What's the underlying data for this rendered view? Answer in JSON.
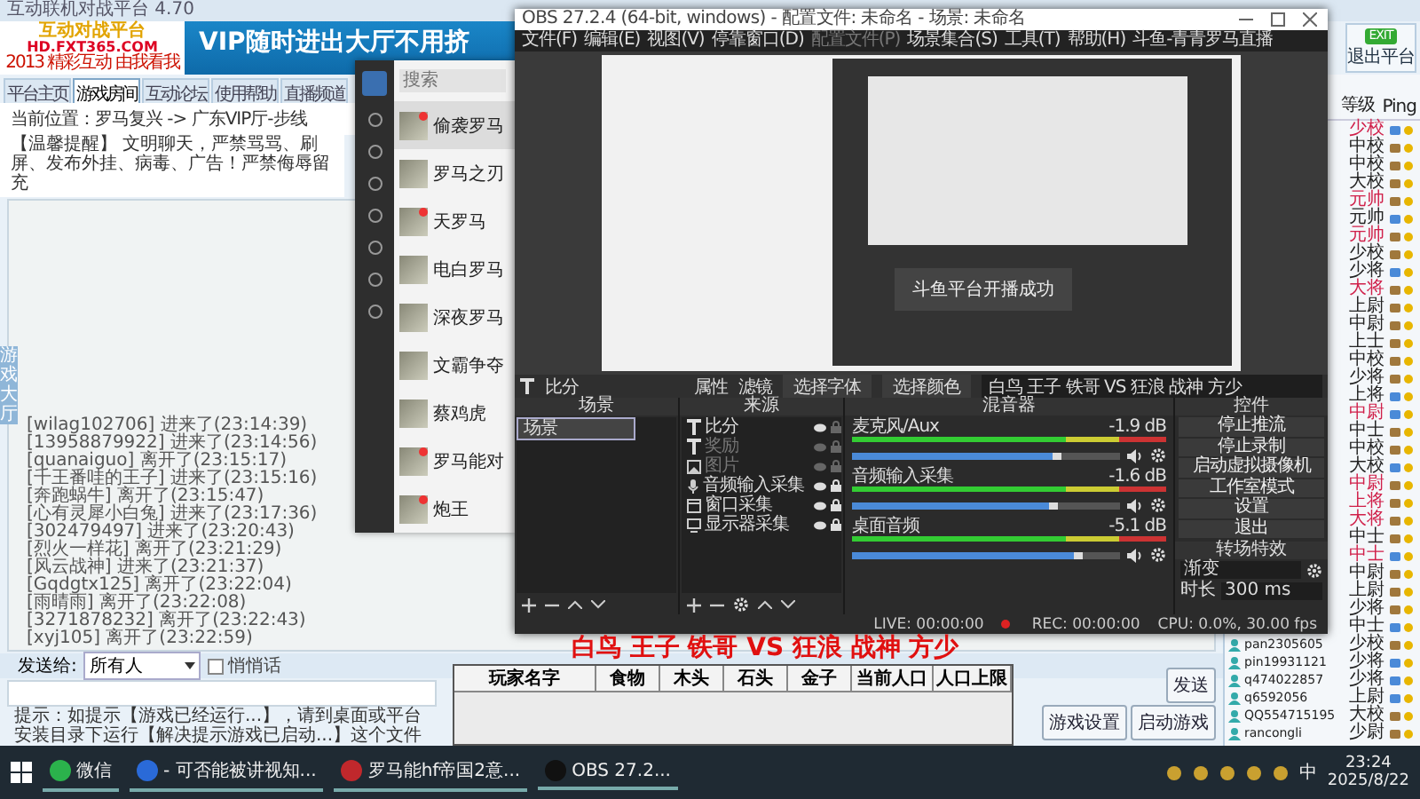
{
  "platform": {
    "title": "互动联机对战平台 4.70",
    "logo": {
      "name": "互动对战平台",
      "site": "HD.FXT365.COM",
      "slogan": "2013 精彩互动 由我看我"
    },
    "banner": "VIP随时进出大厅不用挤",
    "tabs": [
      {
        "label": "平台主页",
        "selected": false
      },
      {
        "label": "游戏房间",
        "selected": true
      },
      {
        "label": "互动论坛",
        "selected": false
      },
      {
        "label": "使用帮助",
        "selected": false
      },
      {
        "label": "直播频道",
        "selected": false
      }
    ],
    "breadcrumb": "当前位置：罗马复兴 -> 广东VIP厅-步线",
    "notice": "【温馨提醒】 文明聊天，严禁骂骂、刷屏、发布外挂、病毒、广告！严禁侮辱留充",
    "side_tab": "游戏大厅",
    "log": [
      "[wilag102706] 进来了(23:14:39)",
      "[13958879922] 进来了(23:14:56)",
      "[quanaiguo] 离开了(23:15:17)",
      "[千王番哇的王子] 进来了(23:15:16)",
      "[奔跑蜗牛] 离开了(23:15:47)",
      "[心有灵犀小白兔] 进来了(23:17:36)",
      "[302479497] 进来了(23:20:43)",
      "[烈火一样花] 离开了(23:21:29)",
      "[风云战神] 进来了(23:21:37)",
      "[Gqdgtx125] 离开了(23:22:04)",
      "[雨晴雨] 离开了(23:22:08)",
      "[3271878232] 离开了(23:22:43)",
      "[xyj105] 离开了(23:22:59)"
    ],
    "send_to": {
      "label": "发送给:",
      "value": "所有人"
    },
    "whisper": {
      "label": "悄悄话",
      "checked": false
    },
    "hint": "提示：如提示【游戏已经运行...】，请到桌面或平台安装目录下运行【解决提示游戏已启动...】这个文件",
    "send_button": "发送",
    "buttons": [
      "游戏设置",
      "启动游戏"
    ],
    "exit_icon": "EXIT",
    "exit_button": "退出平台",
    "user_columns": [
      "等级",
      "Ping"
    ],
    "users": [
      {
        "rank": "少校",
        "vip": true,
        "pc": false
      },
      {
        "rank": "中校",
        "vip": false,
        "pc": true
      },
      {
        "rank": "中校",
        "vip": false,
        "pc": true
      },
      {
        "rank": "大校",
        "vip": false,
        "pc": true
      },
      {
        "rank": "元帅",
        "vip": true,
        "pc": true
      },
      {
        "rank": "元帅",
        "vip": false,
        "pc": false
      },
      {
        "rank": "元帅",
        "vip": true,
        "pc": true
      },
      {
        "rank": "少校",
        "vip": false,
        "pc": true
      },
      {
        "rank": "少将",
        "vip": false,
        "pc": false
      },
      {
        "rank": "大将",
        "vip": true,
        "pc": true
      },
      {
        "rank": "上尉",
        "vip": false,
        "pc": true
      },
      {
        "rank": "中尉",
        "vip": false,
        "pc": true
      },
      {
        "rank": "上士",
        "vip": false,
        "pc": true
      },
      {
        "rank": "中校",
        "vip": false,
        "pc": true
      },
      {
        "rank": "少将",
        "vip": false,
        "pc": true
      },
      {
        "rank": "上将",
        "vip": false,
        "pc": false
      },
      {
        "rank": "中尉",
        "vip": true,
        "pc": false
      },
      {
        "rank": "中士",
        "vip": false,
        "pc": true
      },
      {
        "rank": "中校",
        "vip": false,
        "pc": true
      },
      {
        "rank": "大校",
        "vip": false,
        "pc": false
      },
      {
        "rank": "中尉",
        "vip": true,
        "pc": true
      },
      {
        "rank": "上将",
        "vip": true,
        "pc": true
      },
      {
        "rank": "大将",
        "vip": true,
        "pc": true
      },
      {
        "rank": "中士",
        "vip": false,
        "pc": true
      },
      {
        "rank": "中士",
        "vip": true,
        "pc": false
      },
      {
        "rank": "中尉",
        "vip": false,
        "pc": true
      },
      {
        "rank": "上尉",
        "vip": false,
        "pc": true
      },
      {
        "rank": "少将",
        "vip": false,
        "pc": true
      },
      {
        "rank": "中士",
        "vip": false,
        "pc": false
      },
      {
        "name": "pan2305605",
        "rank": "少校",
        "vip": false,
        "pc": true
      },
      {
        "name": "pin19931121",
        "rank": "少将",
        "vip": false,
        "pc": false
      },
      {
        "name": "q474022857",
        "rank": "少将",
        "vip": false,
        "pc": false
      },
      {
        "name": "q6592056",
        "rank": "上尉",
        "vip": false,
        "pc": false
      },
      {
        "name": "QQ554715195",
        "rank": "大校",
        "vip": false,
        "pc": true
      },
      {
        "name": "rancongli",
        "rank": "少尉",
        "vip": false,
        "pc": true
      }
    ]
  },
  "chat_app": {
    "search": {
      "placeholder": "搜索"
    },
    "chats": [
      {
        "name": "偷袭罗马",
        "unread": true
      },
      {
        "name": "罗马之刃",
        "unread": false
      },
      {
        "name": "天罗马",
        "unread": true
      },
      {
        "name": "电白罗马",
        "unread": false
      },
      {
        "name": "深夜罗马",
        "unread": false
      },
      {
        "name": "文霸争夺",
        "unread": false
      },
      {
        "name": "蔡鸡虎",
        "unread": false
      },
      {
        "name": "罗马能对",
        "unread": true
      },
      {
        "name": "炮王",
        "unread": true
      }
    ]
  },
  "obs": {
    "title": "OBS 27.2.4 (64-bit, windows) - 配置文件: 未命名 - 场景: 未命名",
    "menu": [
      {
        "label": "文件(F)",
        "disabled": false
      },
      {
        "label": "编辑(E)",
        "disabled": false
      },
      {
        "label": "视图(V)",
        "disabled": false
      },
      {
        "label": "停靠窗口(D)",
        "disabled": false
      },
      {
        "label": "配置文件(P)",
        "disabled": true
      },
      {
        "label": "场景集合(S)",
        "disabled": false
      },
      {
        "label": "工具(T)",
        "disabled": false
      },
      {
        "label": "帮助(H)",
        "disabled": false
      },
      {
        "label": "斗鱼-青青罗马直播",
        "disabled": false
      }
    ],
    "preview_toast": "斗鱼平台开播成功",
    "text_toolbar": {
      "source": "比分",
      "buttons": [
        "属性",
        "滤镜",
        "选择字体",
        "选择颜色"
      ],
      "text": "白鸟 王子 铁哥 VS 狂浪 战神 方少"
    },
    "docks": {
      "scenes": "场景",
      "sources": "来源",
      "mixer": "混音器",
      "controls": "控件"
    },
    "scenes": [
      {
        "name": "场景",
        "selected": true
      }
    ],
    "sources": [
      {
        "name": "比分",
        "kind": "text",
        "visible": true,
        "locked": false
      },
      {
        "name": "奖励",
        "kind": "text",
        "visible": false,
        "locked": false
      },
      {
        "name": "图片",
        "kind": "image",
        "visible": false,
        "locked": false
      },
      {
        "name": "音频输入采集",
        "kind": "audio",
        "visible": true,
        "locked": true
      },
      {
        "name": "窗口采集",
        "kind": "window",
        "visible": true,
        "locked": true
      },
      {
        "name": "显示器采集",
        "kind": "display",
        "visible": true,
        "locked": true
      }
    ],
    "channels": [
      {
        "name": "麦克风/Aux",
        "reading": "-1.9 dB",
        "level": 0.78
      },
      {
        "name": "音频输入采集",
        "reading": "-1.6 dB",
        "level": 0.77
      },
      {
        "name": "桌面音频",
        "reading": "-5.1 dB",
        "level": 0.86
      }
    ],
    "controls": [
      "停止推流",
      "停止录制",
      "启动虚拟摄像机",
      "工作室模式",
      "设置",
      "退出"
    ],
    "transition": {
      "title": "转场特效",
      "value": "渐变",
      "duration_label": "时长",
      "duration": "300 ms"
    },
    "status": {
      "live": "LIVE: 00:00:00",
      "rec": "REC: 00:00:00",
      "cpu": "CPU: 0.0%, 30.00 fps"
    }
  },
  "overlay_text": "白鸟 王子 铁哥 VS 狂浪 战神 方少",
  "score_table": {
    "columns": [
      "玩家名字",
      "食物",
      "木头",
      "石头",
      "金子",
      "当前人口",
      "人口上限"
    ]
  },
  "taskbar": {
    "apps": [
      {
        "label": "微信",
        "kind": "wechat"
      },
      {
        "label": "- 可否能被讲视知...",
        "kind": "k"
      },
      {
        "label": "罗马能hf帝国2意...",
        "kind": "game"
      },
      {
        "label": "OBS 27.2...",
        "kind": "obs"
      }
    ],
    "ime": "中",
    "time": "23:24",
    "date": "2025/8/22"
  }
}
